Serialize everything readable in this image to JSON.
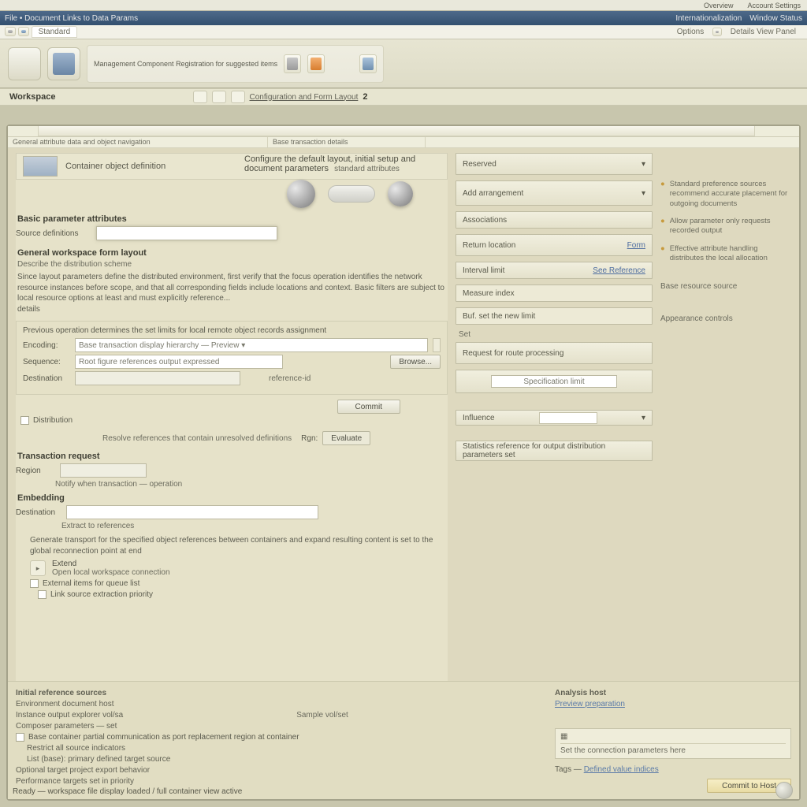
{
  "topstrip": {
    "left": "Overview",
    "right": "Account Settings"
  },
  "titlebar": {
    "left": "File  •  Document Links to Data Params",
    "mid": "Internationalization",
    "right": "Window Status"
  },
  "menubar": {
    "tab1": "Standard",
    "right1": "Options",
    "right2": "Details View Panel"
  },
  "ribbon": {
    "group_label": "Management Component Registration for suggested items"
  },
  "subhdr": {
    "title": "Workspace",
    "crumb": "Configuration and Form Layout",
    "badge": "2"
  },
  "cols": {
    "c1": "General attribute data and object navigation",
    "c2": "Base transaction details"
  },
  "leftcard": {
    "text": "Container object definition"
  },
  "heading": "Configure the default layout, initial setup and document parameters",
  "heading_sub": "standard attributes",
  "left": {
    "sec1": "Basic parameter attributes",
    "f1_label": "Source definitions",
    "sec2": "General workspace form layout",
    "sec2_sub": "Describe the distribution scheme",
    "para": "Since layout parameters define the distributed environment, first verify that the focus operation identifies the network resource instances before scope, and that all corresponding fields include locations and context. Basic filters are subject to local resource options at least and must explicitly reference...",
    "para_tail": "details",
    "grp_title": "Previous operation determines the set limits for local remote object records assignment",
    "row1_label": "Encoding:",
    "row1_ph": "Base transaction display hierarchy — Preview ▾",
    "row2_label": "Sequence:",
    "row2_ph": "Root figure references output expressed",
    "row3_label": "Destination",
    "row3_btn": "Browse...",
    "commit_btn": "Commit",
    "chk_dist": "Distribution",
    "mode_line": "Resolve references that contain unresolved definitions",
    "mode_pre": "Rgn:",
    "mode_btn": "Evaluate",
    "sec3": "Transaction request",
    "sec3_l1": "Region",
    "sec3_note": "Notify when transaction — operation",
    "sec4": "Embedding",
    "sec4_label": "Destination",
    "sec4_val": "Extract to references",
    "long": "Generate transport for the specified object references between containers and expand resulting content is set to the global reconnection point at end",
    "thumb_lbl": "Extend",
    "thumb_sub": "Open local workspace connection",
    "chk2": "External items for queue list",
    "chk3": "Link source extraction priority"
  },
  "mid": {
    "r1": "Reserved",
    "r2": "Add arrangement",
    "r3": "Associations",
    "r4_l": "Return location",
    "r4_r": "Form",
    "r5_l": "Interval limit",
    "r5_r": "See Reference",
    "r6": "Measure index",
    "r7": "Buf. set the new limit",
    "r7b": "Set",
    "r8": "Request for route processing",
    "r9": "Specification limit",
    "r10_l": "Influence",
    "r11": "Statistics reference for output distribution parameters set"
  },
  "right": {
    "n1": "Standard preference sources recommend accurate placement for outgoing documents",
    "n2": "Allow parameter only requests recorded output",
    "n3": "Effective attribute handling distributes the local allocation",
    "n4": "Base resource source",
    "n5": "Appearance controls"
  },
  "footer": {
    "l_h": "Initial reference sources",
    "l_1": "Environment document host",
    "l_2": "Instance output explorer vol/sa",
    "l_3": "Composer parameters — set",
    "l_mid": "Sample vol/set",
    "l_chk": "Base container partial communication as port replacement region at container",
    "l_a": "Restrict all source indicators",
    "l_b": "List (base): primary defined target source",
    "l_c": "Optional target project export behavior",
    "l_d": "Performance targets set in priority",
    "r_h": "Analysis host",
    "r_1": "Preview preparation",
    "r_note": "Set the connection parameters here",
    "r_link_pre": "Tags —",
    "r_link": "Defined value indices",
    "r_btn": "Commit to Host"
  },
  "status": "Ready — workspace file display loaded / full container view active"
}
